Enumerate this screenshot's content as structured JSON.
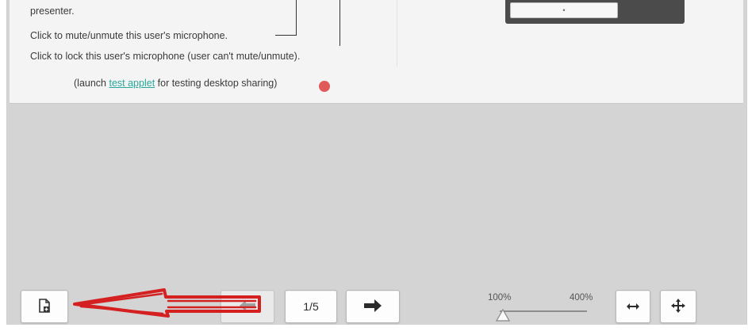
{
  "slide": {
    "line1": "presenter.",
    "line2": "Click to mute/unmute this user's microphone.",
    "line3": "Click to lock this user's microphone (user can't mute/unmute).",
    "line4_prefix": "(launch ",
    "line4_link": "test applet",
    "line4_suffix": " for testing desktop sharing)",
    "mock_field_glyph": "•"
  },
  "toolbar": {
    "upload_icon": "upload-document-icon",
    "prev_icon": "arrow-left-icon",
    "page_indicator": "1/5",
    "next_icon": "arrow-right-icon",
    "zoom_min": "100%",
    "zoom_max": "400%",
    "zoom_value_percent": 100,
    "fit_width_icon": "fit-width-icon",
    "fit_page_icon": "move-icon"
  },
  "colors": {
    "annotation_red": "#d42020",
    "link": "#2aa79a",
    "dot": "#e05a5a"
  }
}
